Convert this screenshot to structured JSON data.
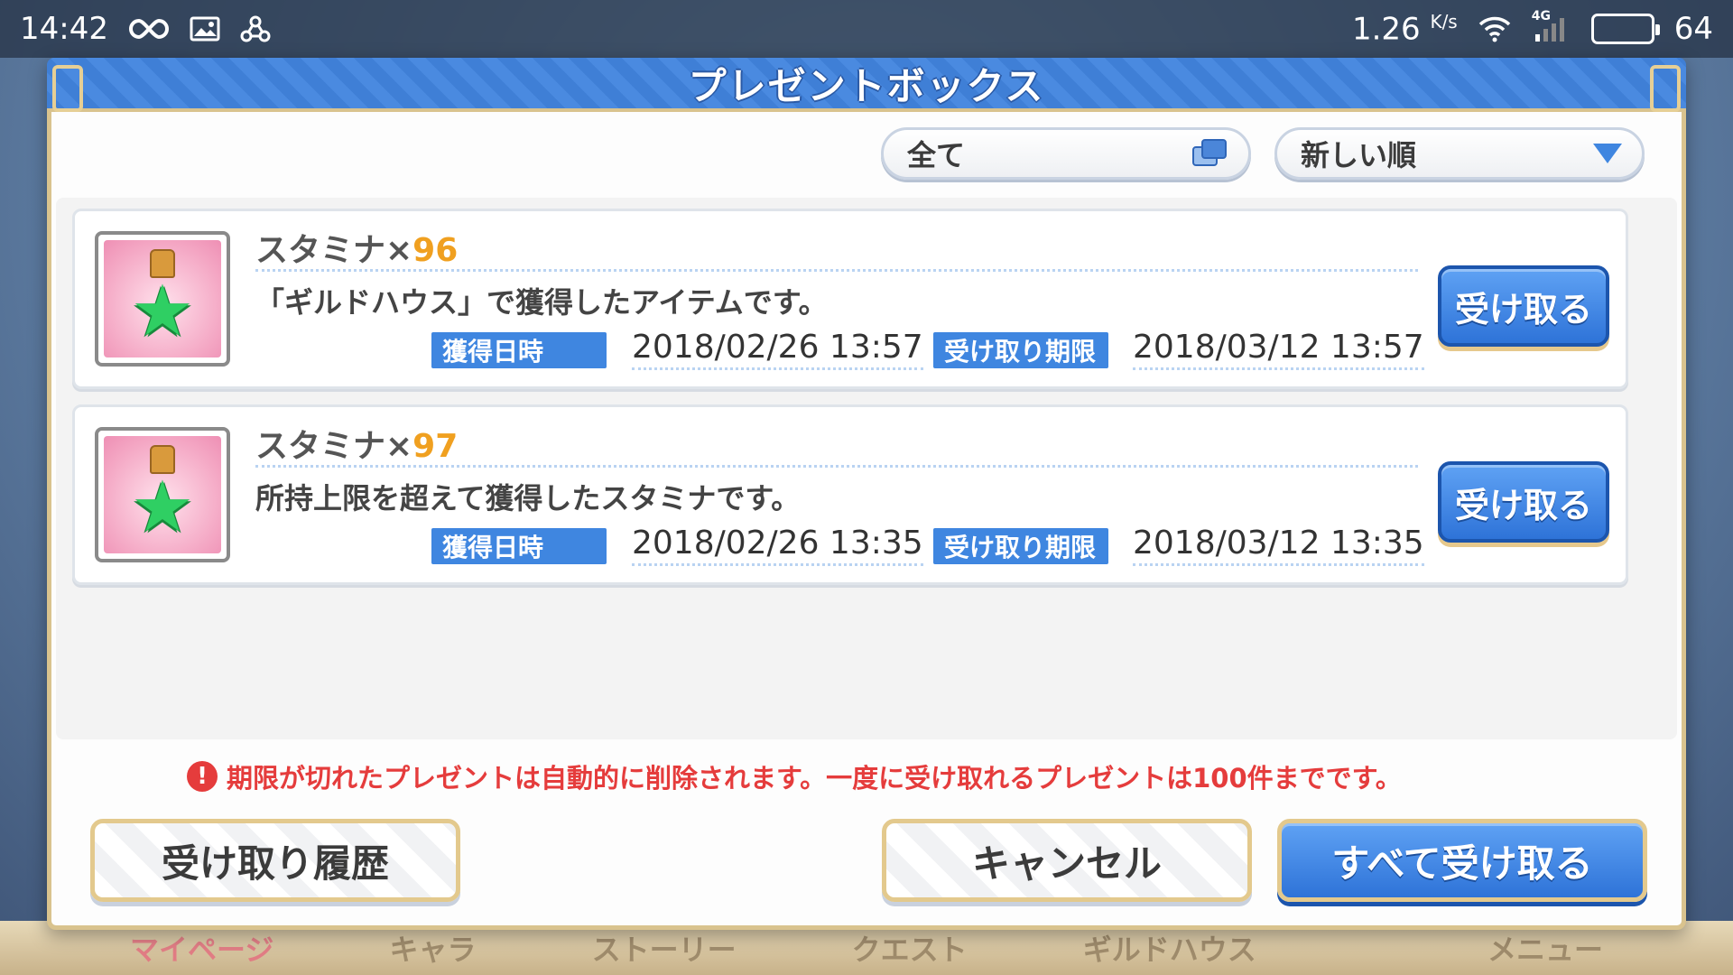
{
  "status_bar": {
    "time": "14:42",
    "speed": "1.26",
    "speed_unit": "K/s",
    "network": "4G",
    "battery": "64",
    "battery_level": 0.64
  },
  "dialog": {
    "title": "プレゼントボックス",
    "filter_type": "全て",
    "filter_sort": "新しい順",
    "items": [
      {
        "name": "スタミナ×",
        "quantity": "96",
        "description": "「ギルドハウス」で獲得したアイテムです。",
        "acquired_label": "獲得日時",
        "acquired_date": "2018/02/26 13:57",
        "expiry_label": "受け取り期限",
        "expiry_date": "2018/03/12 13:57",
        "receive_label": "受け取る"
      },
      {
        "name": "スタミナ×",
        "quantity": "97",
        "description": "所持上限を超えて獲得したスタミナです。",
        "acquired_label": "獲得日時",
        "acquired_date": "2018/02/26 13:35",
        "expiry_label": "受け取り期限",
        "expiry_date": "2018/03/12 13:35",
        "receive_label": "受け取る"
      }
    ],
    "notice": "期限が切れたプレゼントは自動的に削除されます。一度に受け取れるプレゼントは100件までです。",
    "buttons": {
      "history": "受け取り履歴",
      "cancel": "キャンセル",
      "receive_all": "すべて受け取る"
    }
  },
  "background_nav": [
    "マイページ",
    "キャラ",
    "ストーリー",
    "クエスト",
    "ギルドハウス",
    "",
    "メニュー"
  ],
  "colors": {
    "accent_blue": "#3f86e0",
    "quantity_orange": "#f0a020",
    "warning_red": "#e53c3c",
    "frame_gold": "#d9c38e"
  }
}
